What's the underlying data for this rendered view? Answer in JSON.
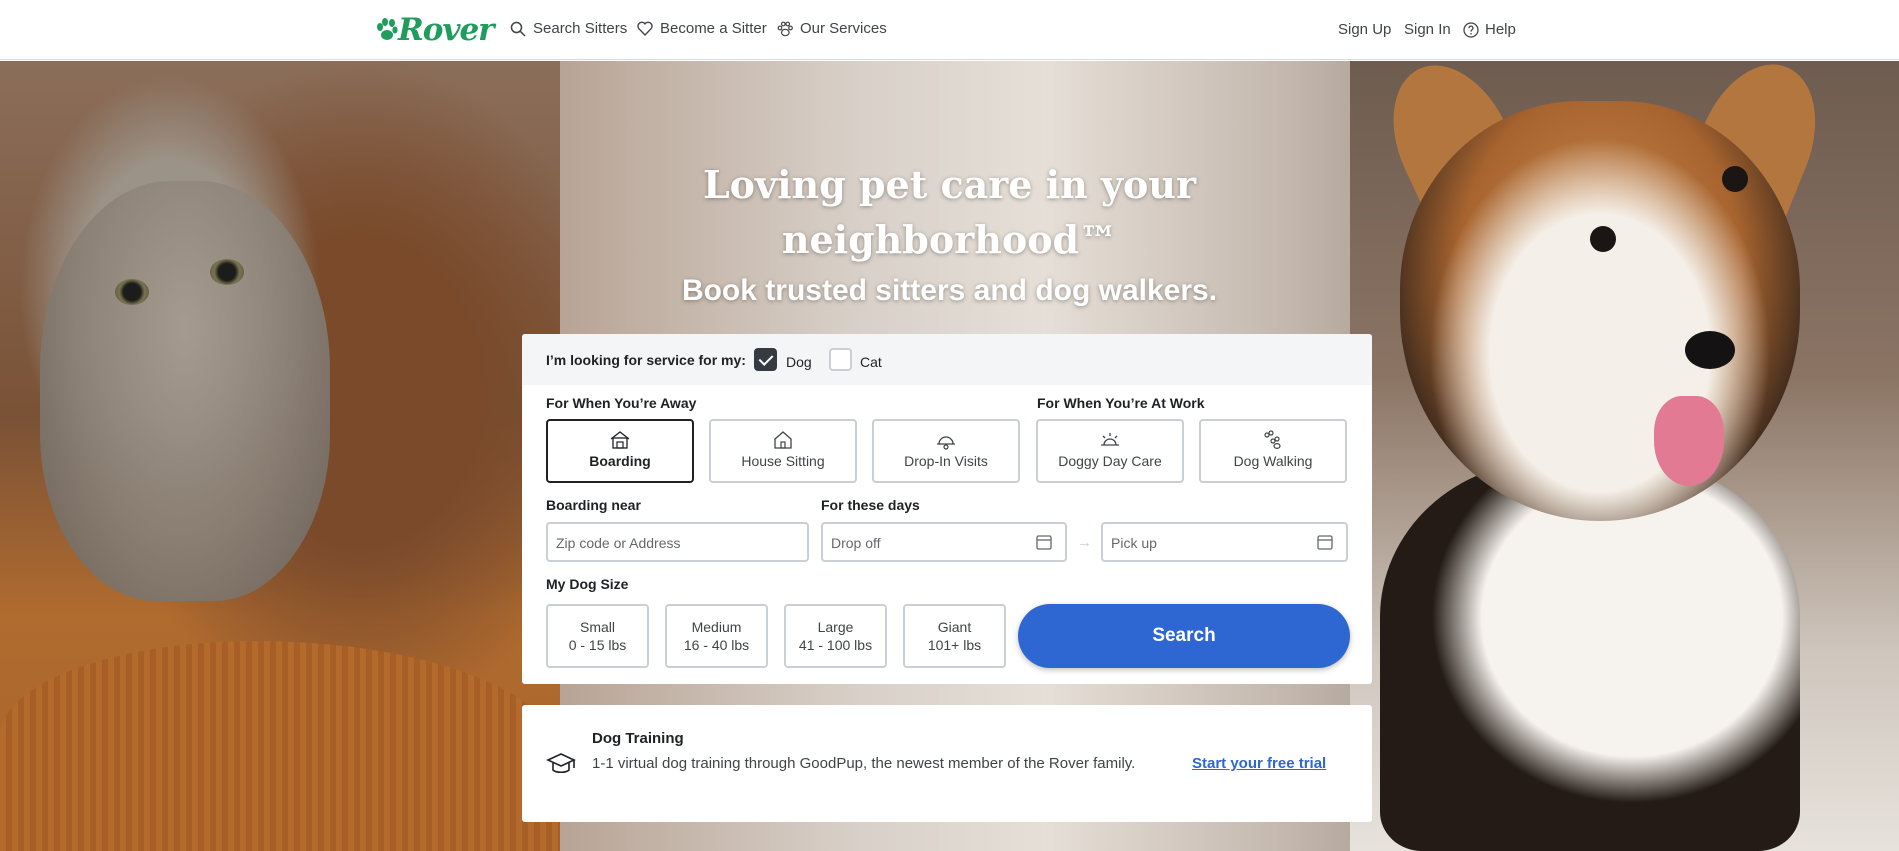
{
  "brand": {
    "logo_text": "Rover",
    "accent_color": "#1f9d5c",
    "primary_button_color": "#2e67d1"
  },
  "nav": {
    "left": [
      {
        "label": "Search Sitters",
        "icon": "search-icon"
      },
      {
        "label": "Become a Sitter",
        "icon": "heart-icon"
      },
      {
        "label": "Our Services",
        "icon": "paw-icon"
      }
    ],
    "sign_up": "Sign Up",
    "sign_in": "Sign In",
    "help": "Help"
  },
  "hero": {
    "title_line1": "Loving pet care in your",
    "title_line2": "neighborhood™",
    "subtitle": "Book trusted sitters and dog walkers."
  },
  "search": {
    "pet_prompt": "I’m looking for service for my:",
    "pets": [
      {
        "label": "Dog",
        "checked": true
      },
      {
        "label": "Cat",
        "checked": false
      }
    ],
    "away_heading": "For When You’re Away",
    "work_heading": "For When You’re At Work",
    "services": [
      {
        "label": "Boarding",
        "icon": "boarding-icon",
        "selected": true
      },
      {
        "label": "House Sitting",
        "icon": "house-icon",
        "selected": false
      },
      {
        "label": "Drop-In Visits",
        "icon": "drop-in-icon",
        "selected": false
      },
      {
        "label": "Doggy Day Care",
        "icon": "sun-icon",
        "selected": false
      },
      {
        "label": "Dog Walking",
        "icon": "paw-prints-icon",
        "selected": false
      }
    ],
    "location_label": "Boarding near",
    "location_placeholder": "Zip code or Address",
    "dates_label": "For these days",
    "drop_off_placeholder": "Drop off",
    "pick_up_placeholder": "Pick up",
    "size_label": "My Dog Size",
    "sizes": [
      {
        "name": "Small",
        "range": "0 - 15 lbs"
      },
      {
        "name": "Medium",
        "range": "16 - 40 lbs"
      },
      {
        "name": "Large",
        "range": "41 - 100 lbs"
      },
      {
        "name": "Giant",
        "range": "101+ lbs"
      }
    ],
    "search_button": "Search"
  },
  "training": {
    "icon": "graduation-cap-icon",
    "title": "Dog Training",
    "description": "1-1 virtual dog training through GoodPup, the newest member of the Rover family.",
    "link": "Start your free trial"
  }
}
